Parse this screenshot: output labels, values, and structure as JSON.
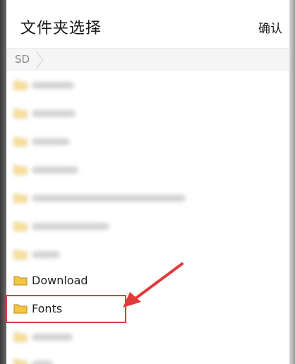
{
  "dialog": {
    "title": "文件夹选择",
    "confirm_label": "确认"
  },
  "breadcrumb": {
    "root": "SD"
  },
  "folders": [
    {
      "name": "",
      "blurred": true
    },
    {
      "name": "",
      "blurred": true
    },
    {
      "name": "",
      "blurred": true
    },
    {
      "name": "",
      "blurred": true
    },
    {
      "name": "",
      "blurred": true
    },
    {
      "name": "",
      "blurred": true
    },
    {
      "name": "",
      "blurred": true
    },
    {
      "name": "Download",
      "blurred": false
    },
    {
      "name": "Fonts",
      "blurred": false,
      "highlighted": true
    },
    {
      "name": "",
      "blurred": true
    },
    {
      "name": "",
      "blurred": true
    }
  ],
  "colors": {
    "folder_fill": "#f5c542",
    "folder_stroke": "#b8891c",
    "highlight": "#e23a3a"
  },
  "icons": {
    "folder": "folder-icon",
    "breadcrumb_separator": "chevron-right-icon",
    "annotation_arrow": "arrow-icon"
  }
}
